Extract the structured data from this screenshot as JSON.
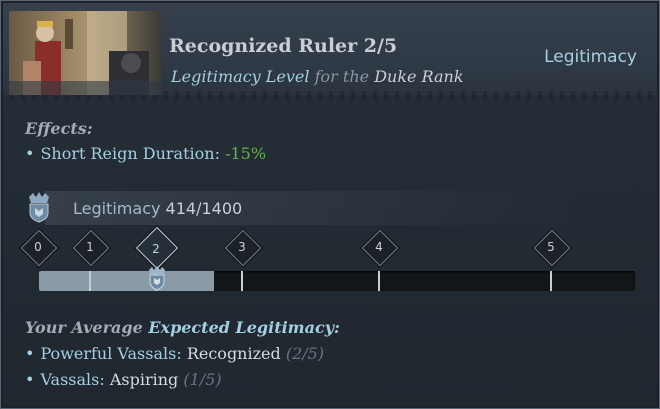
{
  "header": {
    "title": "Recognized Ruler 2/5",
    "subtitle_prefix": "Legitimacy Level",
    "subtitle_mid": " for the ",
    "subtitle_suffix": "Duke Rank",
    "top_right": "Legitimacy"
  },
  "effects": {
    "heading": "Effects:",
    "items": [
      {
        "label": "Short Reign Duration:",
        "value": "-15%"
      }
    ]
  },
  "legitimacy": {
    "label": "Legitimacy",
    "value": "414/1400",
    "current": 414,
    "max": 1400
  },
  "track": {
    "levels": [
      "0",
      "1",
      "2",
      "3",
      "4",
      "5"
    ],
    "active_level": "2"
  },
  "average": {
    "heading_prefix": "Your Average",
    "heading_suffix": "Expected Legitimacy:",
    "rows": [
      {
        "label": "Powerful Vassals:",
        "value": "Recognized",
        "fraction": "(2/5)"
      },
      {
        "label": "Vassals:",
        "value": "Aspiring",
        "fraction": "(1/5)"
      }
    ]
  },
  "colors": {
    "accent": "#a4cfe0",
    "positive": "#66b24a",
    "panel": "#222a33"
  }
}
